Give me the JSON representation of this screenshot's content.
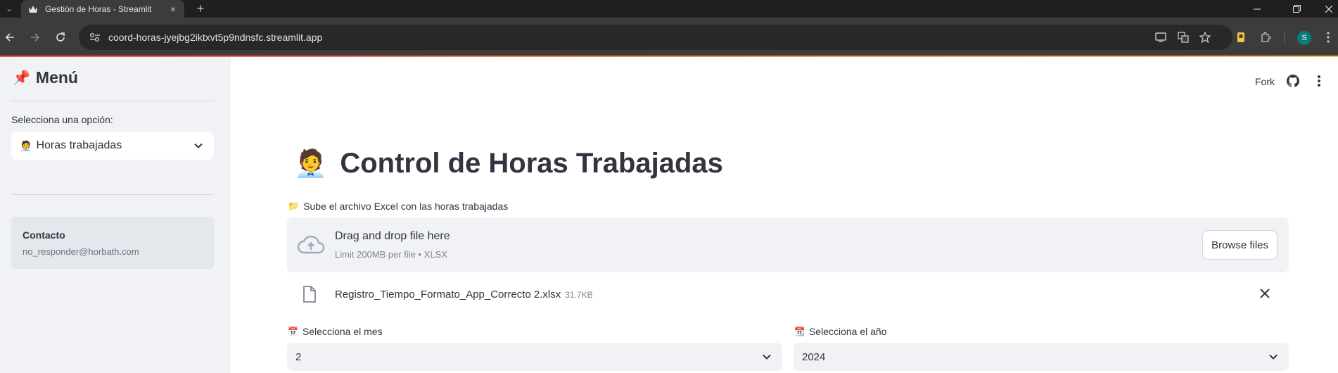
{
  "browser": {
    "tab_title": "Gestión de Horas - Streamlit",
    "new_tab": "+",
    "close_tab": "×",
    "url": "coord-horas-jyejbg2iktxvt5p9ndnsfc.streamlit.app",
    "profile_initial": "S"
  },
  "header": {
    "fork_label": "Fork"
  },
  "sidebar": {
    "title_emoji": "📌",
    "title": "Menú",
    "select_label": "Selecciona una opción:",
    "select_emoji": "🧑‍💼",
    "select_value": "Horas trabajadas",
    "contact_title": "Contacto",
    "contact_email": "no_responder@horbath.com"
  },
  "main": {
    "title_emoji": "🧑‍💼",
    "title": "Control de Horas Trabajadas",
    "upload_emoji": "📁",
    "upload_label": "Sube el archivo Excel con las horas trabajadas",
    "dropzone_text": "Drag and drop file here",
    "dropzone_limit": "Limit 200MB per file • XLSX",
    "browse_button": "Browse files",
    "uploaded_file_name": "Registro_Tiempo_Formato_App_Correcto 2.xlsx",
    "uploaded_file_size": "31.7KB",
    "month_emoji": "📅",
    "month_label": "Selecciona el mes",
    "month_value": "2",
    "year_emoji": "📆",
    "year_label": "Selecciona el año",
    "year_value": "2024"
  },
  "colors": {
    "sidebar_bg": "#f0f2f6",
    "text": "#31333f",
    "muted": "#808495",
    "accent_gradient_start": "#ff4b4b",
    "accent_gradient_end": "#ffbd45"
  }
}
